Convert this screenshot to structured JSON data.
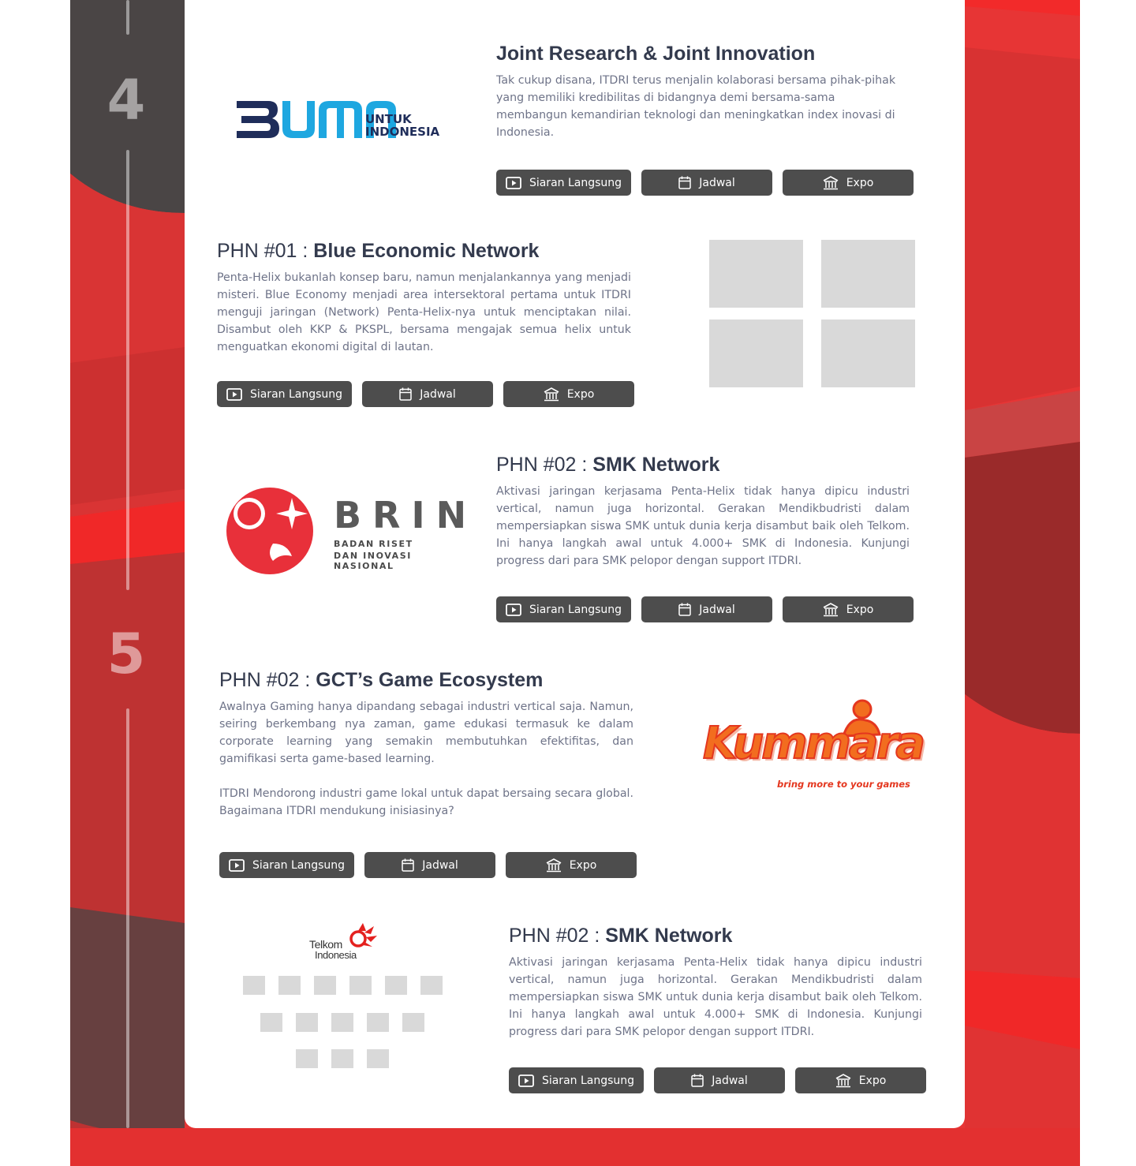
{
  "timeline": {
    "steps": [
      "4",
      "5"
    ]
  },
  "colors": {
    "accent_red": "#e73535",
    "dark_band": "#4a4545",
    "button_bg": "#4d4d4d",
    "title_text": "#333a4d",
    "body_text": "#6e7388",
    "placeholder": "#d9d9d9"
  },
  "buttons": {
    "live_label": "Siaran Langsung",
    "schedule_label": "Jadwal",
    "expo_label": "Expo",
    "live_icon": "play-icon",
    "schedule_icon": "calendar-icon",
    "expo_icon": "building-icon"
  },
  "sections": [
    {
      "title": "Joint Research & Joint Innovation",
      "description": "Tak cukup disana, ITDRI terus menjalin kolaborasi bersama pihak-pihak yang memiliki kredibilitas di bidangnya demi bersama-sama membangun kemandirian teknologi dan meningkatkan index inovasi di Indonesia.",
      "logo": {
        "name": "bumn-logo",
        "mark": "BUMN",
        "line1": "UNTUK",
        "line2": "INDONESIA"
      }
    },
    {
      "title_prefix": "PHN #01 : ",
      "title_main": "Blue Economic Network",
      "description": "Penta-Helix bukanlah konsep baru, namun menjalankannya yang menjadi misteri. Blue Economy menjadi area intersektoral pertama untuk ITDRI menguji jaringan (Network) Penta-Helix-nya untuk menciptakan nilai. Disambut oleh KKP & PKSPL, bersama mengajak semua helix untuk menguatkan ekonomi digital di lautan."
    },
    {
      "title_prefix": "PHN #02 : ",
      "title_main": "SMK Network",
      "description": "Aktivasi jaringan kerjasama Penta-Helix tidak hanya dipicu industri vertical, namun juga horizontal. Gerakan Mendikbudristi dalam mempersiapkan siswa SMK untuk dunia kerja disambut baik oleh Telkom. Ini hanya langkah awal untuk 4.000+ SMK di Indonesia. Kunjungi progress dari para SMK pelopor dengan support ITDRI.",
      "logo": {
        "name": "brin-logo",
        "word": "BRIN",
        "line1": "BADAN RISET",
        "line2": "DAN INOVASI NASIONAL"
      }
    },
    {
      "title_prefix": "PHN #02 : ",
      "title_main": "GCT’s Game Ecosystem",
      "description_p1": "Awalnya Gaming hanya dipandang sebagai industri vertical saja. Namun, seiring berkembang nya zaman, game edukasi termasuk ke dalam corporate learning yang semakin membutuhkan efektifitas, dan gamifikasi serta game-based learning.",
      "description_p2": "ITDRI Mendorong industri game lokal untuk dapat bersaing secara global. Bagaimana ITDRI mendukung inisiasinya?",
      "logo": {
        "name": "kummara-logo",
        "word": "Kummara",
        "tagline": "bring more to your games"
      }
    },
    {
      "title_prefix": "PHN #02 : ",
      "title_main": "SMK Network",
      "description": "Aktivasi jaringan kerjasama Penta-Helix tidak hanya dipicu industri vertical, namun juga horizontal. Gerakan Mendikbudristi dalam mempersiapkan siswa SMK untuk dunia kerja disambut baik oleh Telkom. Ini hanya langkah awal untuk 4.000+ SMK di Indonesia. Kunjungi progress dari para SMK pelopor dengan support ITDRI.",
      "logo": {
        "name": "telkom-logo",
        "line1": "Telkom",
        "line2": "Indonesia"
      }
    }
  ]
}
